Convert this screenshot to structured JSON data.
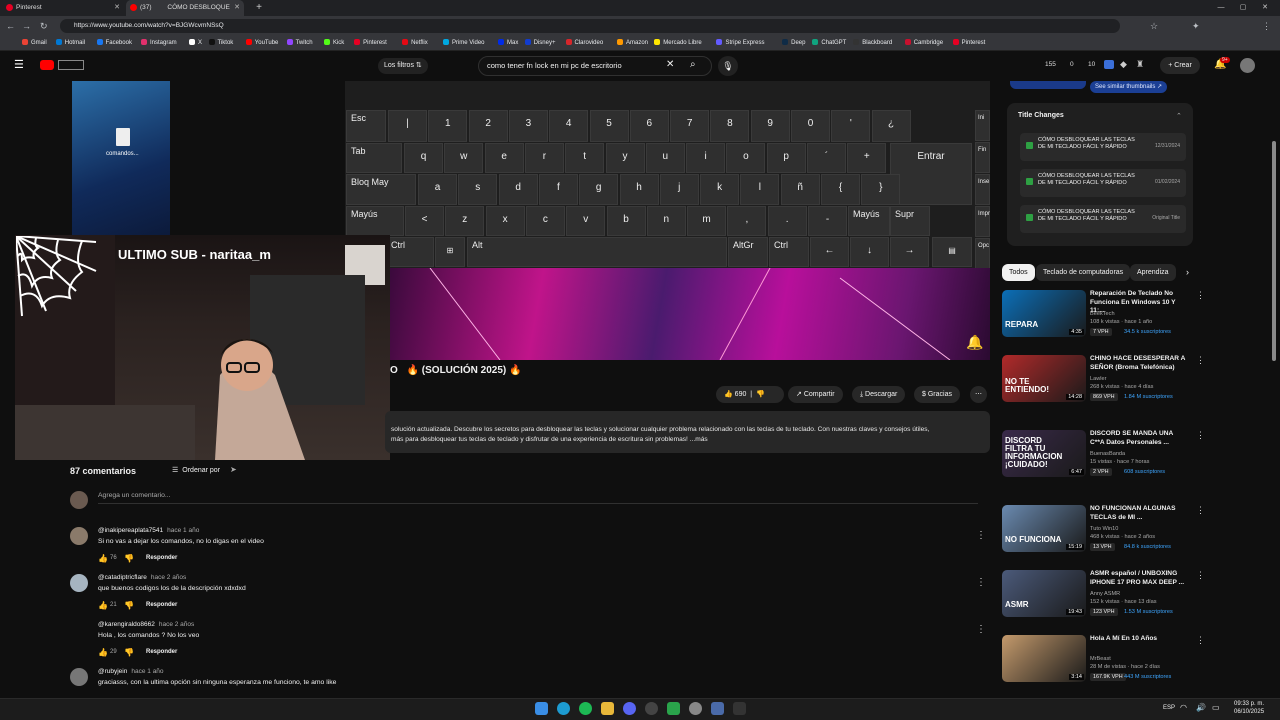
{
  "browser": {
    "tabs": [
      {
        "label": "Pinterest",
        "color": "#e60023"
      },
      {
        "label": "(37)",
        "label2": "CÓMO DESBLOQUE",
        "color": "#ff0000"
      }
    ],
    "url": "https://www.youtube.com/watch?v=BJGWcvmNSsQ",
    "bookmarks": [
      "Gmail",
      "Hotmail",
      "Facebook",
      "Instagram",
      "X",
      "Tiktok",
      "YouTube",
      "Twitch",
      "Kick",
      "Pinterest",
      "Netflix",
      "Prime Video",
      "Max",
      "Disney+",
      "Clarovideo",
      "Amazon",
      "Mercado Libre",
      "Stripe Express",
      "Deep",
      "ChatGPT",
      "Blackboard",
      "Cambridge",
      "Pinterest"
    ]
  },
  "yt": {
    "filters": "Los filtros",
    "search": "como tener fn lock en mi pc de escritorio",
    "stats": [
      "155",
      "0",
      "10"
    ],
    "crear": "Crear",
    "notif": "9+"
  },
  "keyboard": {
    "row1": [
      "Esc",
      "|",
      "1",
      "2",
      "3",
      "4",
      "5",
      "6",
      "7",
      "8",
      "9",
      "0",
      "'",
      "¿"
    ],
    "row2": [
      "Tab",
      "q",
      "w",
      "e",
      "r",
      "t",
      "y",
      "u",
      "i",
      "o",
      "p",
      "´",
      "+",
      "Entrar"
    ],
    "row3": [
      "Bloq May",
      "a",
      "s",
      "d",
      "f",
      "g",
      "h",
      "j",
      "k",
      "l",
      "ñ",
      "{",
      "}"
    ],
    "row4": [
      "Mayús",
      "<",
      "z",
      "x",
      "c",
      "v",
      "b",
      "n",
      "m",
      ",",
      ".",
      "-",
      "Mayús",
      "Supr"
    ],
    "row5": [
      "Ctrl",
      "Alt",
      "AltGr",
      "Ctrl"
    ],
    "side": [
      "Ini",
      "Fin",
      "Inse",
      "Impr",
      "Opc"
    ]
  },
  "stream": {
    "title": "ULTIMO SUB - naritaa_m",
    "desktop_file": "comandos..."
  },
  "video": {
    "title_suffix": "O",
    "title_rest": "(SOLUCIÓN 2025)",
    "likes": "690",
    "share": "Compartir",
    "download": "Descargar",
    "thanks": "Gracias",
    "desc1": "solución actualizada. Descubre los secretos para desbloquear las teclas y solucionar cualquier problema relacionado con las teclas de tu teclado. Con nuestras claves y consejos útiles,",
    "desc2": "más para desbloquear tus teclas de teclado y disfrutar de una experiencia de escritura sin problemas! ...más"
  },
  "comments": {
    "count": "87 comentarios",
    "sort": "Ordenar por",
    "placeholder": "Agrega un comentario...",
    "reply": "Responder",
    "items": [
      {
        "user": "@inakipereaplata7541",
        "time": "hace 1 año",
        "text": "Si no vas a dejar los comandos, no lo digas en el video",
        "likes": "76"
      },
      {
        "user": "@catadiptricflare",
        "time": "hace 2 años",
        "text": "que buenos codigos los de la descripción xdxdxd",
        "likes": "21"
      },
      {
        "user": "@karengiraldo8662",
        "time": "hace 2 años",
        "text": "Hola , los comandos ? No los veo",
        "likes": "29"
      },
      {
        "user": "@rubyjein",
        "time": "hace 1 año",
        "text": "graciasss, con la ultima opción sin ninguna esperanza me funciono, te amo like",
        "likes": ""
      }
    ]
  },
  "sidebar": {
    "similar": "See similar thumbnails",
    "title_changes": "Title Changes",
    "changes": [
      {
        "line1": "CÓMO DESBLOQUEAR LAS TECLAS",
        "line2": "DE MI TECLADO FÁCIL Y RÁPIDO",
        "date": "12/31/2024"
      },
      {
        "line1": "CÓMO DESBLOQUEAR LAS TECLAS",
        "line2": "DE MI TECLADO FÁCIL Y RÁPIDO",
        "date": "01/02/2024"
      },
      {
        "line1": "CÓMO DESBLOQUEAR LAS TECLAS",
        "line2": "DE MI TECLADO FÁCIL Y RÁPIDO",
        "date": "Original Title"
      }
    ],
    "chips": [
      "Todos",
      "Teclado de computadoras",
      "Aprendiza"
    ],
    "recs": [
      {
        "title": "Reparación De Teclado No Funciona En Windows 10 Y 11:...",
        "channel": "BeekTech",
        "meta": "108 k vistas · hace 1 año",
        "vph": "7 VPH",
        "subs": "34.5 k suscriptores",
        "dur": "4:35",
        "thumbtext": "REPARA",
        "color": "#0b6fb8"
      },
      {
        "title": "CHINO HACE DESESPERAR A SEÑOR (Broma Telefónica)",
        "channel": "Lawler",
        "meta": "268 k vistas · hace 4 días",
        "vph": "869 VPH",
        "subs": "1.84 M suscriptores",
        "dur": "14:28",
        "thumbtext": "NO TE ENTIENDO!",
        "color": "#b12a2a"
      },
      {
        "title": "DISCORD SE MANDA UNA C**A Datos Personales ...",
        "channel": "BuenasBanda",
        "meta": "15 vistas · hace 7 horas",
        "vph": "2 VPH",
        "subs": "608 suscriptores",
        "dur": "6:47",
        "thumbtext": "DISCORD FILTRA TU INFORMACION ¡CUIDADO!",
        "color": "#3a2a4a"
      },
      {
        "title": "NO FUNCIONAN ALGUNAS TECLAS de MI ...",
        "channel": "Tuto Win10",
        "meta": "468 k vistas · hace 2 años",
        "vph": "13 VPH",
        "subs": "84.8 k suscriptores",
        "dur": "15:19",
        "thumbtext": "NO FUNCIONA",
        "color": "#6a8ab0"
      },
      {
        "title": "ASMR español / UNBOXING IPHONE 17 PRO MAX DEEP ...",
        "channel": "Anny ASMR",
        "meta": "152 k vistas · hace 13 días",
        "vph": "123 VPH",
        "subs": "1.53 M suscriptores",
        "dur": "19:43",
        "thumbtext": "ASMR",
        "color": "#4b5a7a"
      },
      {
        "title": "Hola A Mí En 10 Años",
        "channel": "MrBeast",
        "meta": "28 M de vistas · hace 2 días",
        "vph": "167.9K VPH",
        "subs": "443 M suscriptores",
        "dur": "3:14",
        "thumbtext": "",
        "color": "#c49a6c"
      }
    ]
  },
  "taskbar": {
    "lang": "ESP",
    "time": "09:33 p. m.",
    "date": "06/10/2025"
  }
}
